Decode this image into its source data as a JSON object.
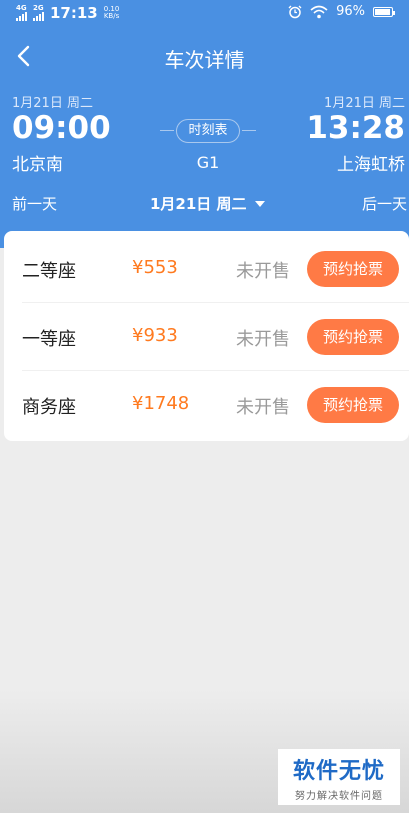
{
  "status_bar": {
    "network_1": "4G",
    "network_2": "2G",
    "time": "17:13",
    "speed_value": "0.10",
    "speed_unit": "KB/s",
    "battery": "96%"
  },
  "nav": {
    "title": "车次详情"
  },
  "trip": {
    "depart_date": "1月21日 周二",
    "depart_time": "09:00",
    "depart_station": "北京南",
    "arrive_date": "1月21日 周二",
    "arrive_time": "13:28",
    "arrive_station": "上海虹桥",
    "schedule_label": "时刻表",
    "train_no": "G1"
  },
  "date_bar": {
    "prev": "前一天",
    "current": "1月21日 周二",
    "next": "后一天"
  },
  "seats": [
    {
      "name": "二等座",
      "price": "¥553",
      "status": "未开售",
      "action": "预约抢票"
    },
    {
      "name": "一等座",
      "price": "¥933",
      "status": "未开售",
      "action": "预约抢票"
    },
    {
      "name": "商务座",
      "price": "¥1748",
      "status": "未开售",
      "action": "预约抢票"
    }
  ],
  "watermark": {
    "title": "软件无忧",
    "subtitle": "努力解决软件问题"
  }
}
